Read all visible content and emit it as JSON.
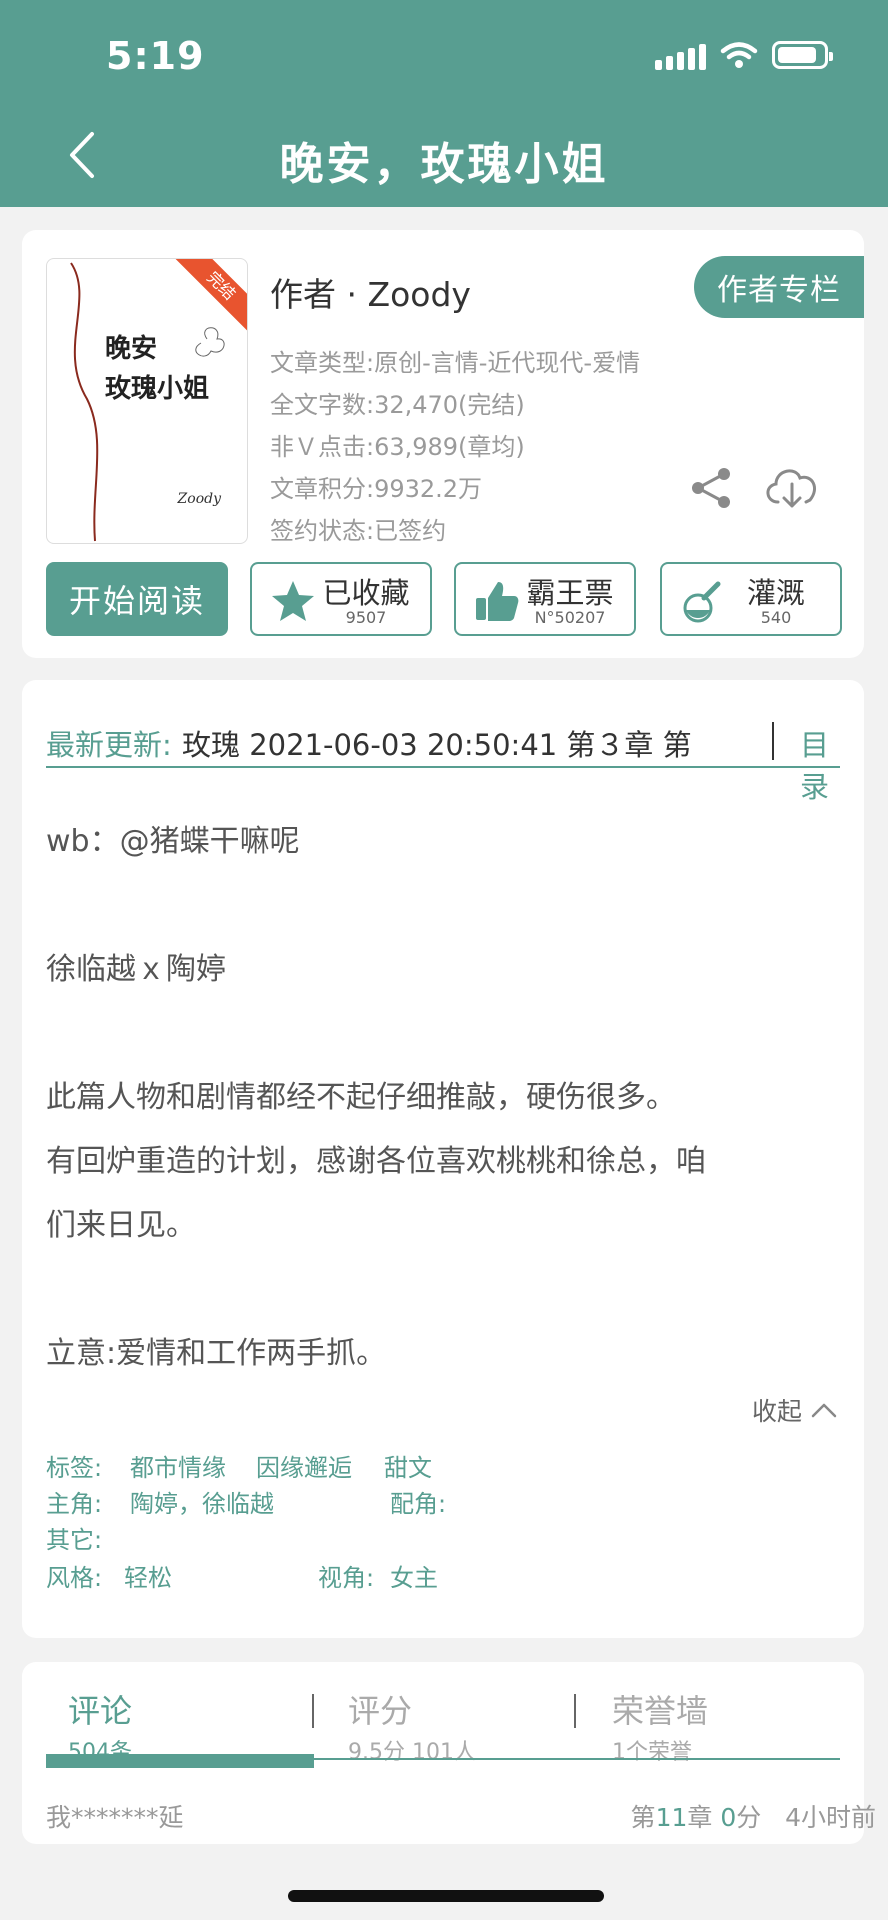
{
  "status_bar": {
    "time": "5:19"
  },
  "header": {
    "title": "晚安，玫瑰小姐"
  },
  "book": {
    "cover_title": "晚安\n玫瑰小姐",
    "cover_author": "Zoody",
    "cover_badge": "完结",
    "author_line": "作者 · Zoody",
    "author_column_button": "作者专栏",
    "meta": [
      "文章类型:原创-言情-近代现代-爱情",
      "全文字数:32,470(完结)",
      "非Ｖ点击:63,989(章均)",
      "文章积分:9932.2万",
      "签约状态:已签约"
    ]
  },
  "actions": {
    "read": "开始阅读",
    "favorite": {
      "label": "已收藏",
      "count": "9507"
    },
    "vote": {
      "label": "霸王票",
      "count": "N°50207"
    },
    "water": {
      "label": "灌溉",
      "count": "540"
    }
  },
  "update": {
    "label": "最新更新:",
    "text": "玫瑰 2021-06-03 20:50:41  第３章 第",
    "catalog": "目录"
  },
  "intro": [
    "wb：@猪蝶干嘛呢",
    "",
    "徐临越ｘ陶婷",
    "",
    "此篇人物和剧情都经不起仔细推敲，硬伤很多。",
    "有回炉重造的计划，感谢各位喜欢桃桃和徐总，咱",
    "们来日见。",
    "",
    "立意:爱情和工作两手抓。"
  ],
  "collapse_label": "收起",
  "tags": {
    "tags_label": "标签:",
    "tags_values": [
      "都市情缘",
      "因缘邂逅",
      "甜文"
    ],
    "lead_label": "主角:",
    "lead_value": "陶婷，徐临越",
    "support_label": "配角:",
    "other_label": "其它:",
    "style_label": "风格:",
    "style_value": "轻松",
    "view_label": "视角:",
    "view_value": "女主"
  },
  "tabs": [
    {
      "title": "评论",
      "sub": "504条"
    },
    {
      "title": "评分",
      "sub": "9.5分 101人"
    },
    {
      "title": "荣誉墙",
      "sub": "1个荣誉"
    }
  ],
  "comment": {
    "user": "我*******延",
    "chapter_prefix": "第",
    "chapter_num": "11",
    "chapter_mid": "章 ",
    "score_num": "0",
    "score_suffix": "分",
    "time": "4小时前"
  },
  "colors": {
    "accent": "#589e91",
    "badge": "#e8542f"
  }
}
